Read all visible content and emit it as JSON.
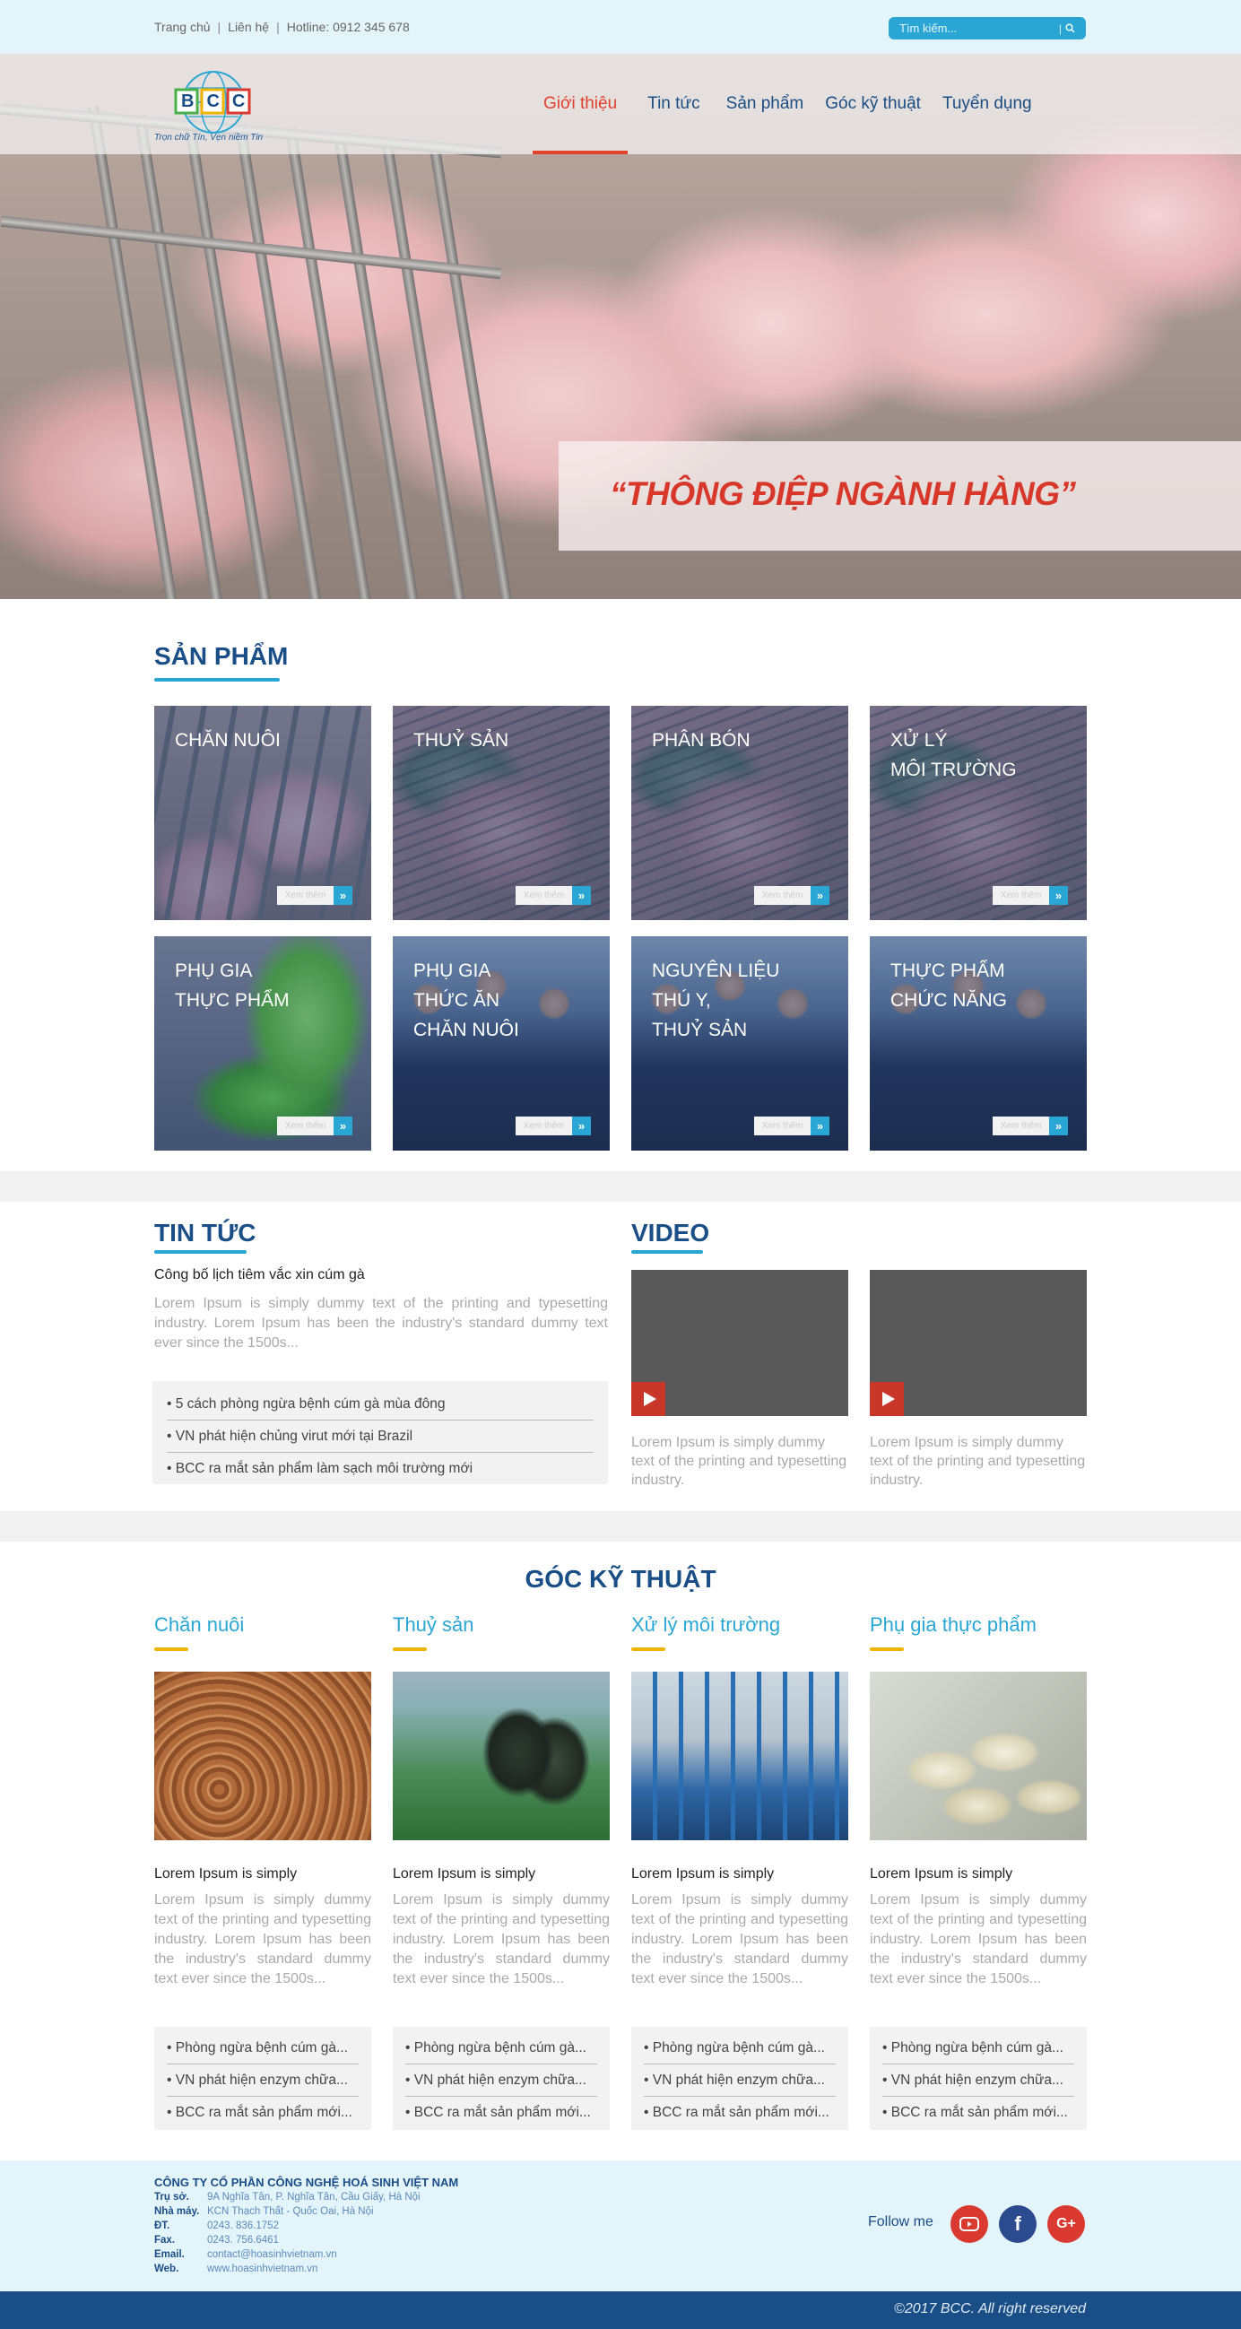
{
  "topbar": {
    "links": [
      "Trang chủ",
      "Liên hệ",
      "Hotline: 0912 345 678"
    ],
    "separator": "|",
    "search_placeholder": "Tìm kiếm..."
  },
  "logo": {
    "text": "BCC",
    "tagline": "Trọn chữ Tín, Vẹn niềm Tin"
  },
  "nav": {
    "items": [
      "Giới thiệu",
      "Tin tức",
      "Sản phẩm",
      "Góc kỹ thuật",
      "Tuyển dụng"
    ],
    "active": "Giới thiệu"
  },
  "hero": {
    "slogan": "“THÔNG ĐIỆP NGÀNH HÀNG”"
  },
  "products": {
    "title": "SẢN PHẨM",
    "button_label": "Xem thêm",
    "items": [
      {
        "label": "CHĂN NUÔI"
      },
      {
        "label": "THUỶ SẢN"
      },
      {
        "label": "PHÂN BÓN"
      },
      {
        "label": "XỬ LÝ\nMÔI TRƯỜNG"
      },
      {
        "label": "PHỤ GIA\nTHỰC PHẨM"
      },
      {
        "label": "PHỤ GIA\nTHỨC ĂN\nCHĂN NUÔI"
      },
      {
        "label": "NGUYÊN LIỆU\nTHÚ Y,\nTHUỶ SẢN"
      },
      {
        "label": "THỰC PHẨM\nCHỨC NĂNG"
      }
    ]
  },
  "news": {
    "title": "TIN TỨC",
    "featured_title": "Công bố lịch tiêm vắc xin cúm gà",
    "featured_text": "Lorem Ipsum is simply dummy text of the printing and typesetting industry. Lorem Ipsum has been the industry's standard dummy text ever since the 1500s...",
    "list": [
      "• 5 cách phòng ngừa bệnh cúm gà mùa đông",
      "• VN phát hiện chủng virut mới tại Brazil",
      "• BCC ra mắt sản phẩm làm sạch môi trường mới"
    ]
  },
  "video": {
    "title": "VIDEO",
    "items": [
      {
        "caption": "Lorem Ipsum is simply dummy text of the printing and typesetting industry."
      },
      {
        "caption": "Lorem Ipsum is simply dummy text of the printing and typesetting industry."
      }
    ]
  },
  "tech": {
    "title": "GÓC KỸ THUẬT",
    "columns": [
      {
        "category": "Chăn nuôi",
        "subtitle": "Lorem Ipsum is simply",
        "text": "Lorem Ipsum is simply dummy text of the printing and typesetting industry. Lorem Ipsum has been the industry's standard dummy text ever since the 1500s...",
        "list": [
          "• Phòng ngừa bệnh cúm gà...",
          "• VN phát hiện enzym chữa...",
          "• BCC ra mắt sản phẩm mới..."
        ]
      },
      {
        "category": "Thuỷ sản",
        "subtitle": "Lorem Ipsum is simply",
        "text": "Lorem Ipsum is simply dummy text of the printing and typesetting industry. Lorem Ipsum has been the industry's standard dummy text ever since the 1500s...",
        "list": [
          "• Phòng ngừa bệnh cúm gà...",
          "• VN phát hiện enzym chữa...",
          "• BCC ra mắt sản phẩm mới..."
        ]
      },
      {
        "category": "Xử lý môi trường",
        "subtitle": "Lorem Ipsum is simply",
        "text": "Lorem Ipsum is simply dummy text of the printing and typesetting industry. Lorem Ipsum has been the industry's standard dummy text ever since the 1500s...",
        "list": [
          "• Phòng ngừa bệnh cúm gà...",
          "• VN phát hiện enzym chữa...",
          "• BCC ra mắt sản phẩm mới..."
        ]
      },
      {
        "category": "Phụ gia thực phẩm",
        "subtitle": "Lorem Ipsum is simply",
        "text": "Lorem Ipsum is simply dummy text of the printing and typesetting industry. Lorem Ipsum has been the industry's standard dummy text ever since the 1500s...",
        "list": [
          "• Phòng ngừa bệnh cúm gà...",
          "• VN phát hiện enzym chữa...",
          "• BCC ra mắt sản phẩm mới..."
        ]
      }
    ]
  },
  "footer": {
    "company": "CÔNG TY CỔ PHẦN CÔNG NGHỆ HOÁ SINH VIỆT NAM",
    "rows": [
      {
        "key": "Trụ sở.",
        "value": "9A Nghĩa Tân, P. Nghĩa Tân, Cầu Giấy, Hà Nội"
      },
      {
        "key": "Nhà máy.",
        "value": "KCN Thạch Thất - Quốc Oai, Hà Nội"
      },
      {
        "key": "ĐT.",
        "value": "0243. 836.1752"
      },
      {
        "key": "Fax.",
        "value": "0243. 756.6461"
      },
      {
        "key": "Email.",
        "value": "contact@hoasinhvietnam.vn"
      },
      {
        "key": "Web.",
        "value": "www.hoasinhvietnam.vn"
      }
    ],
    "follow_label": "Follow me",
    "social": [
      {
        "icon": "youtube-icon",
        "color": "#d9392e"
      },
      {
        "icon": "facebook-icon",
        "glyph": "f",
        "color": "#2c4b8f"
      },
      {
        "icon": "google-plus-icon",
        "glyph": "G+",
        "color": "#d9392e"
      }
    ],
    "copyright": "©2017 BCC. All right reserved"
  },
  "colors": {
    "brand_blue": "#1a4e86",
    "accent_cyan": "#2aa6d4",
    "accent_red": "#e2412e",
    "accent_yellow": "#f0b400"
  }
}
